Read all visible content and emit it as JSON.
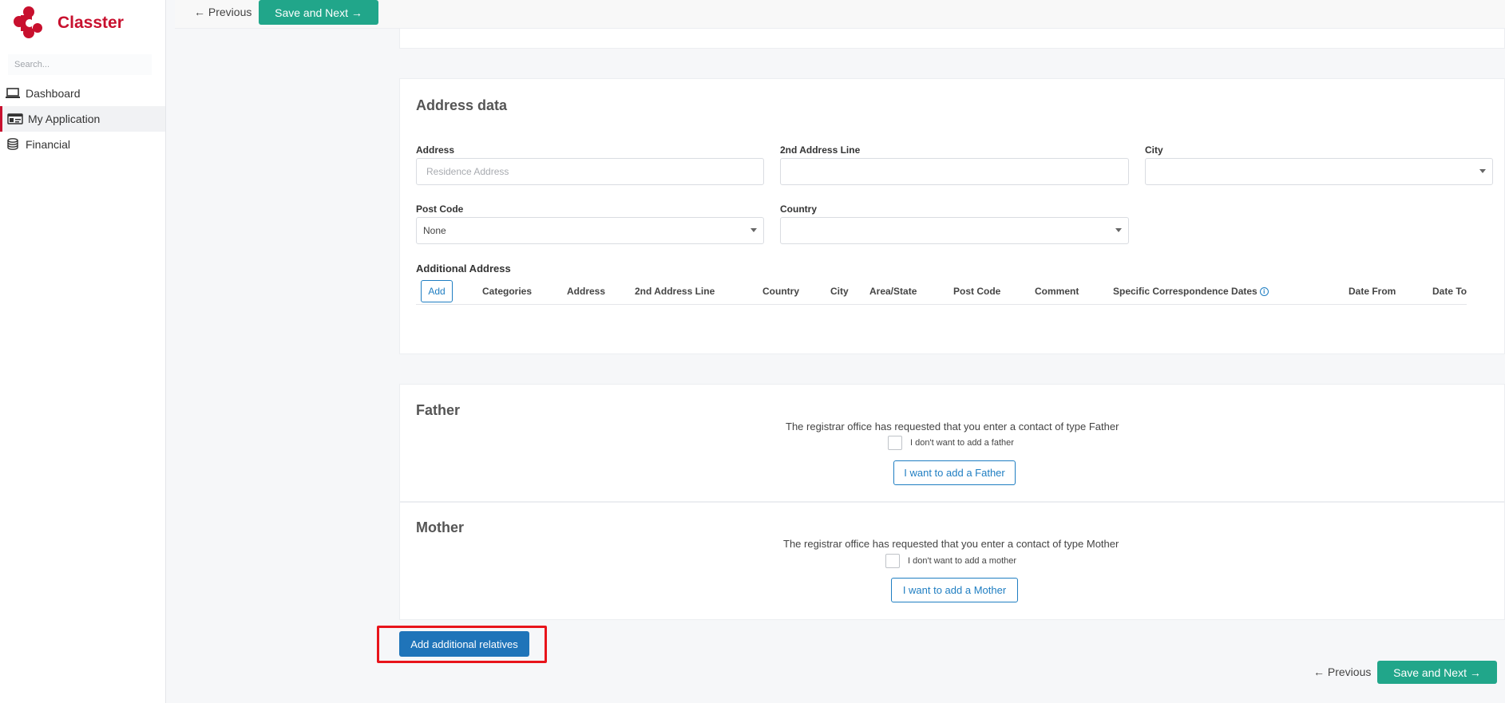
{
  "brand": {
    "name": "Classter"
  },
  "search": {
    "placeholder": "Search..."
  },
  "sidebar": {
    "items": [
      {
        "label": "Dashboard",
        "icon": "laptop-icon"
      },
      {
        "label": "My Application",
        "icon": "id-card-icon",
        "active": true
      },
      {
        "label": "Financial",
        "icon": "coins-icon"
      }
    ]
  },
  "nav": {
    "previous": "← Previous",
    "save_next": "Save and Next →"
  },
  "address": {
    "title": "Address data",
    "address_label": "Address",
    "address_placeholder": "Residence Address",
    "line2_label": "2nd Address Line",
    "city_label": "City",
    "postcode_label": "Post Code",
    "postcode_value": "None",
    "country_label": "Country",
    "additional_title": "Additional Address",
    "add_label": "Add",
    "columns": [
      "Categories",
      "Address",
      "2nd Address Line",
      "Country",
      "City",
      "Area/State",
      "Post Code",
      "Comment",
      "Specific Correspondence Dates",
      "Date From",
      "Date To"
    ]
  },
  "father": {
    "title": "Father",
    "message": "The registrar office has requested that you enter a contact of type Father",
    "checkbox_label": "I don't want to add a father",
    "button": "I want to add a Father"
  },
  "mother": {
    "title": "Mother",
    "message": "The registrar office has requested that you enter a contact of type Mother",
    "checkbox_label": "I don't want to add a mother",
    "button": "I want to add a Mother"
  },
  "relatives": {
    "button": "Add additional relatives"
  },
  "colors": {
    "brand": "#c8102e",
    "accent": "#21a68a",
    "primary": "#1f74b9",
    "highlight": "#e8141b"
  }
}
